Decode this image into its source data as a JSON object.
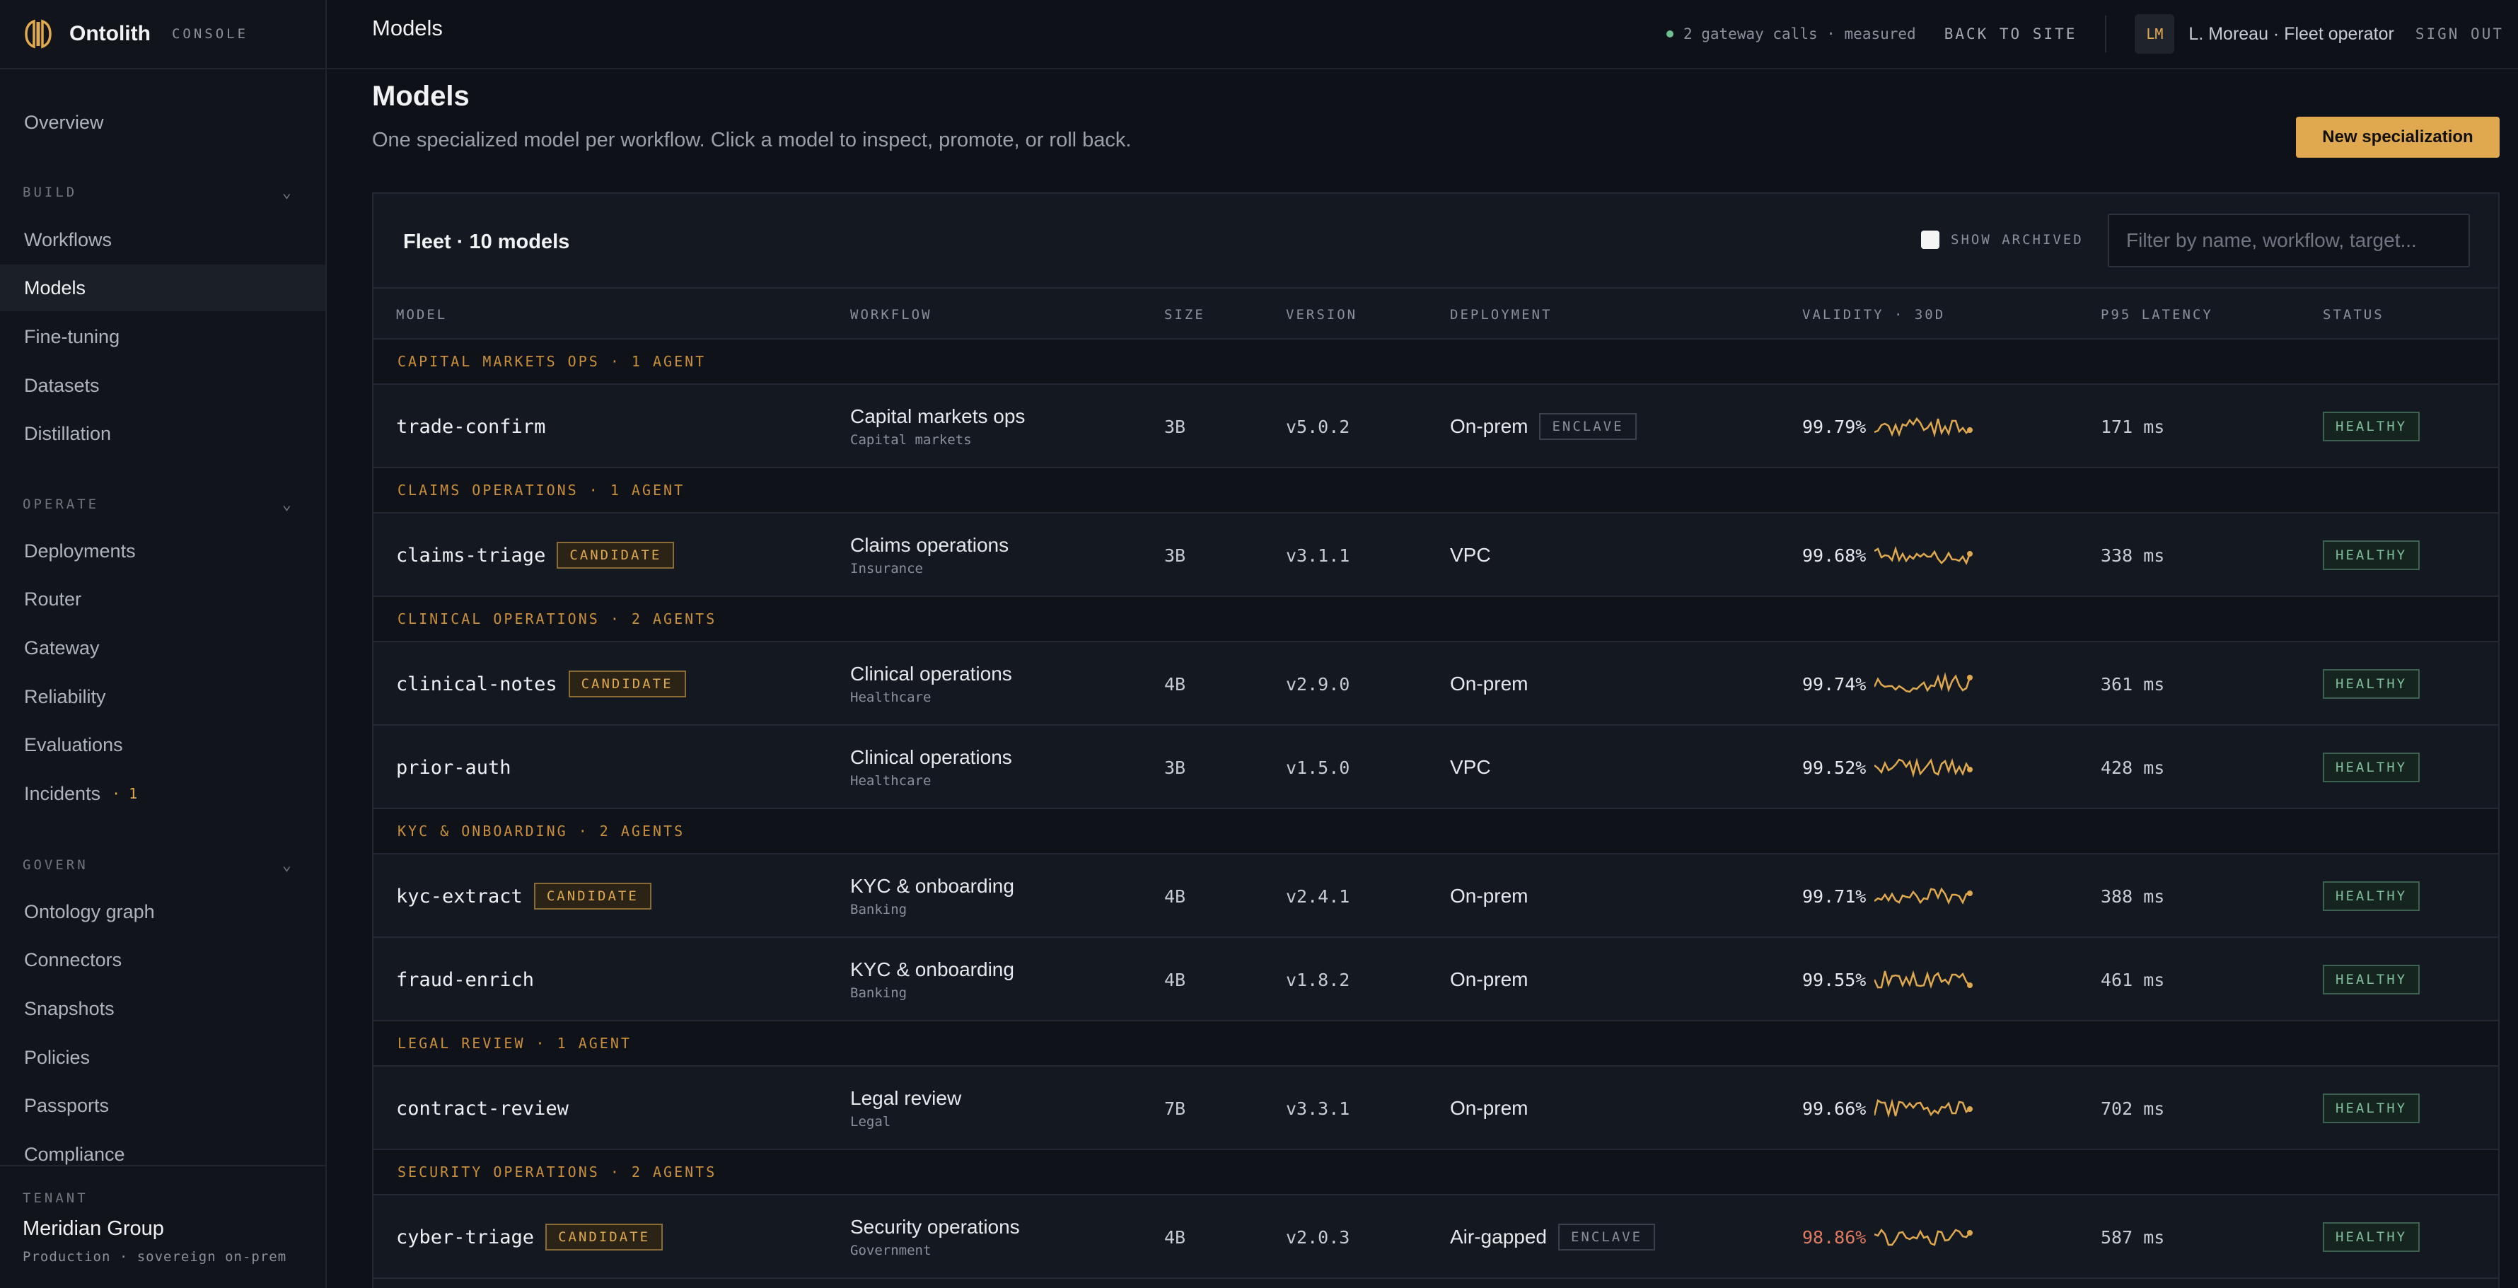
{
  "brand": {
    "name": "Ontolith",
    "sub": "CONSOLE"
  },
  "sidebar": {
    "overview": "Overview",
    "sections": [
      {
        "label": "BUILD",
        "items": [
          "Workflows",
          "Models",
          "Fine-tuning",
          "Datasets",
          "Distillation"
        ]
      },
      {
        "label": "OPERATE",
        "items": [
          "Deployments",
          "Router",
          "Gateway",
          "Reliability",
          "Evaluations",
          "Incidents"
        ]
      },
      {
        "label": "GOVERN",
        "items": [
          "Ontology graph",
          "Connectors",
          "Snapshots",
          "Policies",
          "Passports",
          "Compliance"
        ]
      }
    ],
    "active": "Models",
    "incidents_count": "· 1",
    "tenant": {
      "label": "TENANT",
      "name": "Meridian Group",
      "sub": "Production · sovereign on-prem"
    }
  },
  "topbar": {
    "title": "Models",
    "status": "2 gateway calls · measured",
    "back": "BACK TO SITE",
    "avatar": "LM",
    "user": "L. Moreau · Fleet operator",
    "signout": "SIGN OUT"
  },
  "page": {
    "title": "Models",
    "subtitle": "One specialized model per workflow. Click a model to inspect, promote, or roll back.",
    "new_button": "New specialization"
  },
  "card": {
    "title": "Fleet · 10 models",
    "show_archived": "SHOW ARCHIVED",
    "filter_placeholder": "Filter by name, workflow, target..."
  },
  "columns": [
    "MODEL",
    "WORKFLOW",
    "SIZE",
    "VERSION",
    "DEPLOYMENT",
    "VALIDITY · 30D",
    "P95 LATENCY",
    "STATUS"
  ],
  "rows": [
    {
      "type": "group",
      "label": "CAPITAL MARKETS OPS · 1 AGENT"
    },
    {
      "type": "model",
      "name": "trade-confirm",
      "candidate": "",
      "workflow": "Capital markets ops",
      "sector": "Capital markets",
      "size": "3B",
      "version": "v5.0.2",
      "deployment": "On-prem",
      "enclave": "ENCLAVE",
      "validity": "99.79%",
      "warn": false,
      "latency": "171 ms",
      "status": "HEALTHY"
    },
    {
      "type": "group",
      "label": "CLAIMS OPERATIONS · 1 AGENT"
    },
    {
      "type": "model",
      "name": "claims-triage",
      "candidate": "CANDIDATE",
      "workflow": "Claims operations",
      "sector": "Insurance",
      "size": "3B",
      "version": "v3.1.1",
      "deployment": "VPC",
      "enclave": "",
      "validity": "99.68%",
      "warn": false,
      "latency": "338 ms",
      "status": "HEALTHY"
    },
    {
      "type": "group",
      "label": "CLINICAL OPERATIONS · 2 AGENTS"
    },
    {
      "type": "model",
      "name": "clinical-notes",
      "candidate": "CANDIDATE",
      "workflow": "Clinical operations",
      "sector": "Healthcare",
      "size": "4B",
      "version": "v2.9.0",
      "deployment": "On-prem",
      "enclave": "",
      "validity": "99.74%",
      "warn": false,
      "latency": "361 ms",
      "status": "HEALTHY"
    },
    {
      "type": "model",
      "name": "prior-auth",
      "candidate": "",
      "workflow": "Clinical operations",
      "sector": "Healthcare",
      "size": "3B",
      "version": "v1.5.0",
      "deployment": "VPC",
      "enclave": "",
      "validity": "99.52%",
      "warn": false,
      "latency": "428 ms",
      "status": "HEALTHY"
    },
    {
      "type": "group",
      "label": "KYC & ONBOARDING · 2 AGENTS"
    },
    {
      "type": "model",
      "name": "kyc-extract",
      "candidate": "CANDIDATE",
      "workflow": "KYC & onboarding",
      "sector": "Banking",
      "size": "4B",
      "version": "v2.4.1",
      "deployment": "On-prem",
      "enclave": "",
      "validity": "99.71%",
      "warn": false,
      "latency": "388 ms",
      "status": "HEALTHY"
    },
    {
      "type": "model",
      "name": "fraud-enrich",
      "candidate": "",
      "workflow": "KYC & onboarding",
      "sector": "Banking",
      "size": "4B",
      "version": "v1.8.2",
      "deployment": "On-prem",
      "enclave": "",
      "validity": "99.55%",
      "warn": false,
      "latency": "461 ms",
      "status": "HEALTHY"
    },
    {
      "type": "group",
      "label": "LEGAL REVIEW · 1 AGENT"
    },
    {
      "type": "model",
      "name": "contract-review",
      "candidate": "",
      "workflow": "Legal review",
      "sector": "Legal",
      "size": "7B",
      "version": "v3.3.1",
      "deployment": "On-prem",
      "enclave": "",
      "validity": "99.66%",
      "warn": false,
      "latency": "702 ms",
      "status": "HEALTHY"
    },
    {
      "type": "group",
      "label": "SECURITY OPERATIONS · 2 AGENTS"
    },
    {
      "type": "model",
      "name": "cyber-triage",
      "candidate": "CANDIDATE",
      "workflow": "Security operations",
      "sector": "Government",
      "size": "4B",
      "version": "v2.0.3",
      "deployment": "Air-gapped",
      "enclave": "ENCLAVE",
      "validity": "98.86%",
      "warn": true,
      "latency": "587 ms",
      "status": "HEALTHY"
    }
  ],
  "colors": {
    "accent": "#e0a94f",
    "healthy": "#7fbf9c",
    "warn": "#e07b5f",
    "sparkline": "#e0a94f"
  }
}
